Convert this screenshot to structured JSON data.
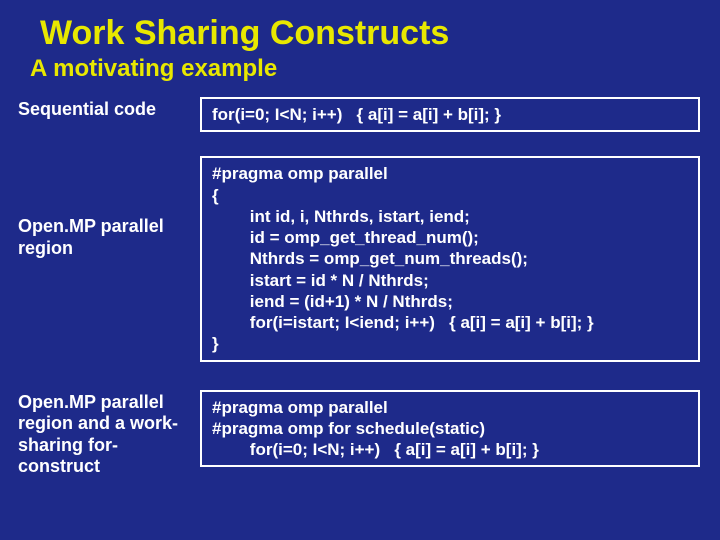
{
  "title": "Work Sharing Constructs",
  "subtitle": "A motivating example",
  "rows": [
    {
      "label": "Sequential code",
      "code": "for(i=0; I<N; i++)   { a[i] = a[i] + b[i]; }"
    },
    {
      "label": "Open.MP parallel region",
      "code": "#pragma omp parallel\n{\n        int id, i, Nthrds, istart, iend;\n        id = omp_get_thread_num();\n        Nthrds = omp_get_num_threads();\n        istart = id * N / Nthrds;\n        iend = (id+1) * N / Nthrds;\n        for(i=istart; I<iend; i++)   { a[i] = a[i] + b[i]; }\n}"
    },
    {
      "label": "Open.MP parallel region and a work-sharing for-construct",
      "code": "#pragma omp parallel\n#pragma omp for schedule(static)\n        for(i=0; I<N; i++)   { a[i] = a[i] + b[i]; }"
    }
  ]
}
